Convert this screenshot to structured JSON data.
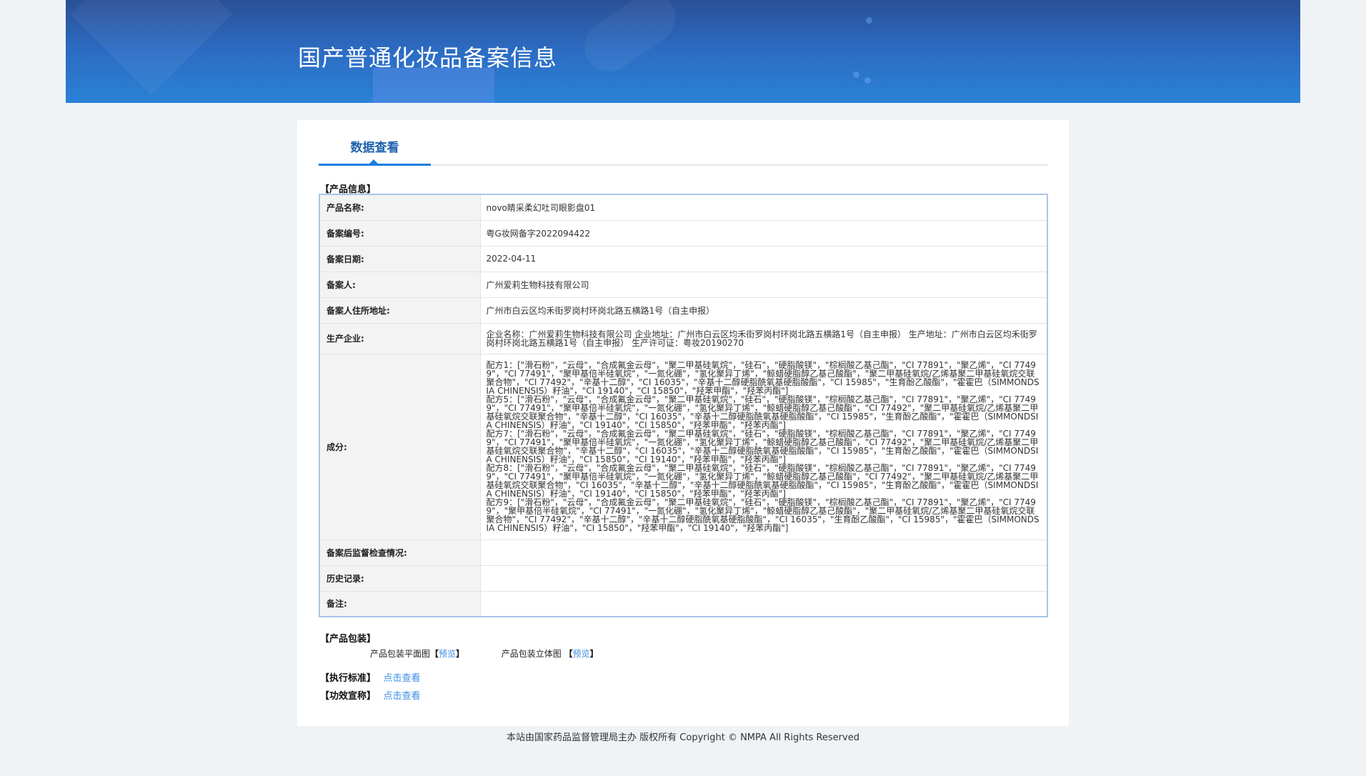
{
  "header": {
    "title": "国产普通化妆品备案信息"
  },
  "tabs": [
    {
      "label": "数据查看",
      "active": true
    }
  ],
  "product_info": {
    "section_title": "【产品信息】",
    "rows": [
      {
        "key": "产品名称:",
        "value": "novo睛采柔幻吐司眼影盘01"
      },
      {
        "key": "备案编号:",
        "value": "粤G妆网备字2022094422"
      },
      {
        "key": "备案日期:",
        "value": "2022-04-11"
      },
      {
        "key": "备案人:",
        "value": "广州爱莉生物科技有限公司"
      },
      {
        "key": "备案人住所地址:",
        "value": "广州市白云区均禾街罗岗村环岗北路五横路1号（自主申报）"
      },
      {
        "key": "生产企业:",
        "value": "企业名称：广州爱莉生物科技有限公司 企业地址：广州市白云区均禾街罗岗村环岗北路五横路1号（自主申报） 生产地址：广州市白云区均禾街罗岗村环岗北路五横路1号（自主申报） 生产许可证：粤妆20190270"
      }
    ],
    "ingredients_key": "成分:",
    "ingredients": [
      "配方1：[\"滑石粉\"，\"云母\"，\"合成氟金云母\"，\"聚二甲基硅氧烷\"，\"硅石\"，\"硬脂酸镁\"，\"棕榈酸乙基己酯\"，\"CI 77891\"，\"聚乙烯\"，\"CI 77499\"，\"CI 77491\"，\"聚甲基倍半硅氧烷\"，\"一氮化硼\"，\"氢化聚异丁烯\"，\"鲸蜡硬脂醇乙基己酸酯\"，\"聚二甲基硅氧烷/乙烯基聚二甲基硅氧烷交联聚合物\"，\"CI 77492\"，\"辛基十二醇\"，\"CI 16035\"，\"辛基十二醇硬脂酰氧基硬脂酸酯\"，\"CI 15985\"，\"生育酚乙酸酯\"，\"霍霍巴（SIMMONDSIA CHINENSIS）籽油\"，\"CI 19140\"，\"CI 15850\"，\"羟苯甲酯\"，\"羟苯丙酯\"]",
      "配方5：[\"滑石粉\"，\"云母\"，\"合成氟金云母\"，\"聚二甲基硅氧烷\"，\"硅石\"，\"硬脂酸镁\"，\"棕榈酸乙基己酯\"，\"CI 77891\"，\"聚乙烯\"，\"CI 77499\"，\"CI 77491\"，\"聚甲基倍半硅氧烷\"，\"一氮化硼\"，\"氢化聚异丁烯\"，\"鲸蜡硬脂醇乙基己酸酯\"，\"CI 77492\"，\"聚二甲基硅氧烷/乙烯基聚二甲基硅氧烷交联聚合物\"，\"辛基十二醇\"，\"CI 16035\"，\"辛基十二醇硬脂酰氧基硬脂酸酯\"，\"CI 15985\"，\"生育酚乙酸酯\"，\"霍霍巴（SIMMONDSIA CHINENSIS）籽油\"，\"CI 19140\"，\"CI 15850\"，\"羟苯甲酯\"，\"羟苯丙酯\"]",
      "配方7：[\"滑石粉\"，\"云母\"，\"合成氟金云母\"，\"聚二甲基硅氧烷\"，\"硅石\"，\"硬脂酸镁\"，\"棕榈酸乙基己酯\"，\"CI 77891\"，\"聚乙烯\"，\"CI 77499\"，\"CI 77491\"，\"聚甲基倍半硅氧烷\"，\"一氮化硼\"，\"氢化聚异丁烯\"，\"鲸蜡硬脂醇乙基己酸酯\"，\"CI 77492\"，\"聚二甲基硅氧烷/乙烯基聚二甲基硅氧烷交联聚合物\"，\"辛基十二醇\"，\"CI 16035\"，\"辛基十二醇硬脂酰氧基硬脂酸酯\"，\"CI 15985\"，\"生育酚乙酸酯\"，\"霍霍巴（SIMMONDSIA CHINENSIS）籽油\"，\"CI 15850\"，\"CI 19140\"，\"羟苯甲酯\"，\"羟苯丙酯\"]",
      "配方8：[\"滑石粉\"，\"云母\"，\"合成氟金云母\"，\"聚二甲基硅氧烷\"，\"硅石\"，\"硬脂酸镁\"，\"棕榈酸乙基己酯\"，\"CI 77891\"，\"聚乙烯\"，\"CI 77499\"，\"CI 77491\"，\"聚甲基倍半硅氧烷\"，\"一氮化硼\"，\"氢化聚异丁烯\"，\"鲸蜡硬脂醇乙基己酸酯\"，\"CI 77492\"，\"聚二甲基硅氧烷/乙烯基聚二甲基硅氧烷交联聚合物\"，\"CI 16035\"，\"辛基十二醇\"，\"辛基十二醇硬脂酰氧基硬脂酸酯\"，\"CI 15985\"，\"生育酚乙酸酯\"，\"霍霍巴（SIMMONDSIA CHINENSIS）籽油\"，\"CI 19140\"，\"CI 15850\"，\"羟苯甲酯\"，\"羟苯丙酯\"]",
      "配方9：[\"滑石粉\"，\"云母\"，\"合成氟金云母\"，\"聚二甲基硅氧烷\"，\"硅石\"，\"硬脂酸镁\"，\"棕榈酸乙基己酯\"，\"CI 77891\"，\"聚乙烯\"，\"CI 77499\"，\"聚甲基倍半硅氧烷\"，\"CI 77491\"，\"一氮化硼\"，\"氢化聚异丁烯\"，\"鲸蜡硬脂醇乙基己酸酯\"，\"聚二甲基硅氧烷/乙烯基聚二甲基硅氧烷交联聚合物\"，\"CI 77492\"，\"辛基十二醇\"，\"辛基十二醇硬脂酰氧基硬脂酸酯\"，\"CI 16035\"，\"生育酚乙酸酯\"，\"CI 15985\"，\"霍霍巴（SIMMONDSIA CHINENSIS）籽油\"，\"CI 15850\"，\"羟苯甲酯\"，\"CI 19140\"，\"羟苯丙酯\"]"
    ],
    "tail_rows": [
      {
        "key": "备案后监督检查情况:",
        "value": ""
      },
      {
        "key": "历史记录:",
        "value": ""
      },
      {
        "key": "备注:",
        "value": ""
      }
    ]
  },
  "packaging": {
    "section_title": "【产品包装】",
    "flat_label": "产品包装平面图",
    "stereo_label": "产品包装立体图",
    "preview_link": "预览",
    "bracket_open": "【",
    "bracket_close": "】"
  },
  "standard": {
    "label": "【执行标准】",
    "link": "点击查看"
  },
  "efficacy": {
    "label": "【功效宣称】",
    "link": "点击查看"
  },
  "footer": {
    "text": "本站由国家药品监督管理局主办 版权所有 Copyright © NMPA All Rights Reserved"
  },
  "colors": {
    "accent": "#1b7de0",
    "link": "#3a8ee6",
    "header": "#2c6cc3"
  }
}
